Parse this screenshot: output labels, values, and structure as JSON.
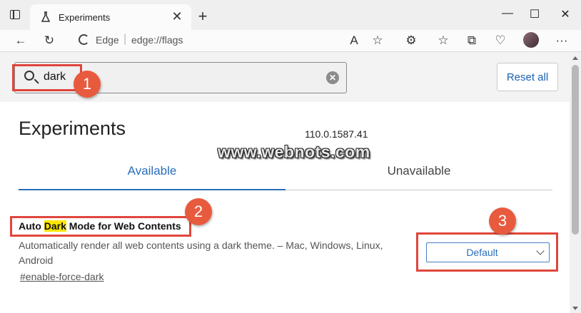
{
  "browser": {
    "tab_title": "Experiments",
    "tab_close": "✕",
    "new_tab": "+",
    "window_controls": {
      "minimize": "—",
      "maximize": "☐",
      "close": "✕"
    },
    "address_brand": "Edge",
    "address_url": "edge://flags",
    "icons": [
      "sidebar-toggle-icon",
      "flask-icon",
      "back-icon",
      "refresh-icon",
      "read-aloud-icon",
      "add-favorite-icon",
      "extensions-icon",
      "favorites-icon",
      "collections-icon",
      "browser-essentials-icon",
      "profile-avatar",
      "more-icon"
    ]
  },
  "toolbar": {
    "back": "←",
    "refresh": "↻",
    "read_aloud": "A",
    "add_favorite": "☆",
    "extensions": "⚙",
    "favorites": "☆",
    "collections": "⧉",
    "essentials": "♡",
    "more": "···"
  },
  "search": {
    "value": "dark",
    "clear": "✕"
  },
  "reset_label": "Reset all",
  "page": {
    "title": "Experiments",
    "version": "110.0.1587.41",
    "watermark": "www.webnots.com",
    "tabs": [
      {
        "label": "Available",
        "active": true
      },
      {
        "label": "Unavailable",
        "active": false
      }
    ]
  },
  "flag": {
    "title_before": "Auto ",
    "title_highlight": "Dark",
    "title_after": " Mode for Web Contents",
    "description": "Automatically render all web contents using a dark theme. – Mac, Windows, Linux, Android",
    "link": "#enable-force-dark",
    "selected": "Default"
  },
  "annotations": [
    "1",
    "2",
    "3"
  ],
  "colors": {
    "accent": "#2a6ebb",
    "annotation": "#e0463c",
    "highlight": "#ffe600"
  }
}
